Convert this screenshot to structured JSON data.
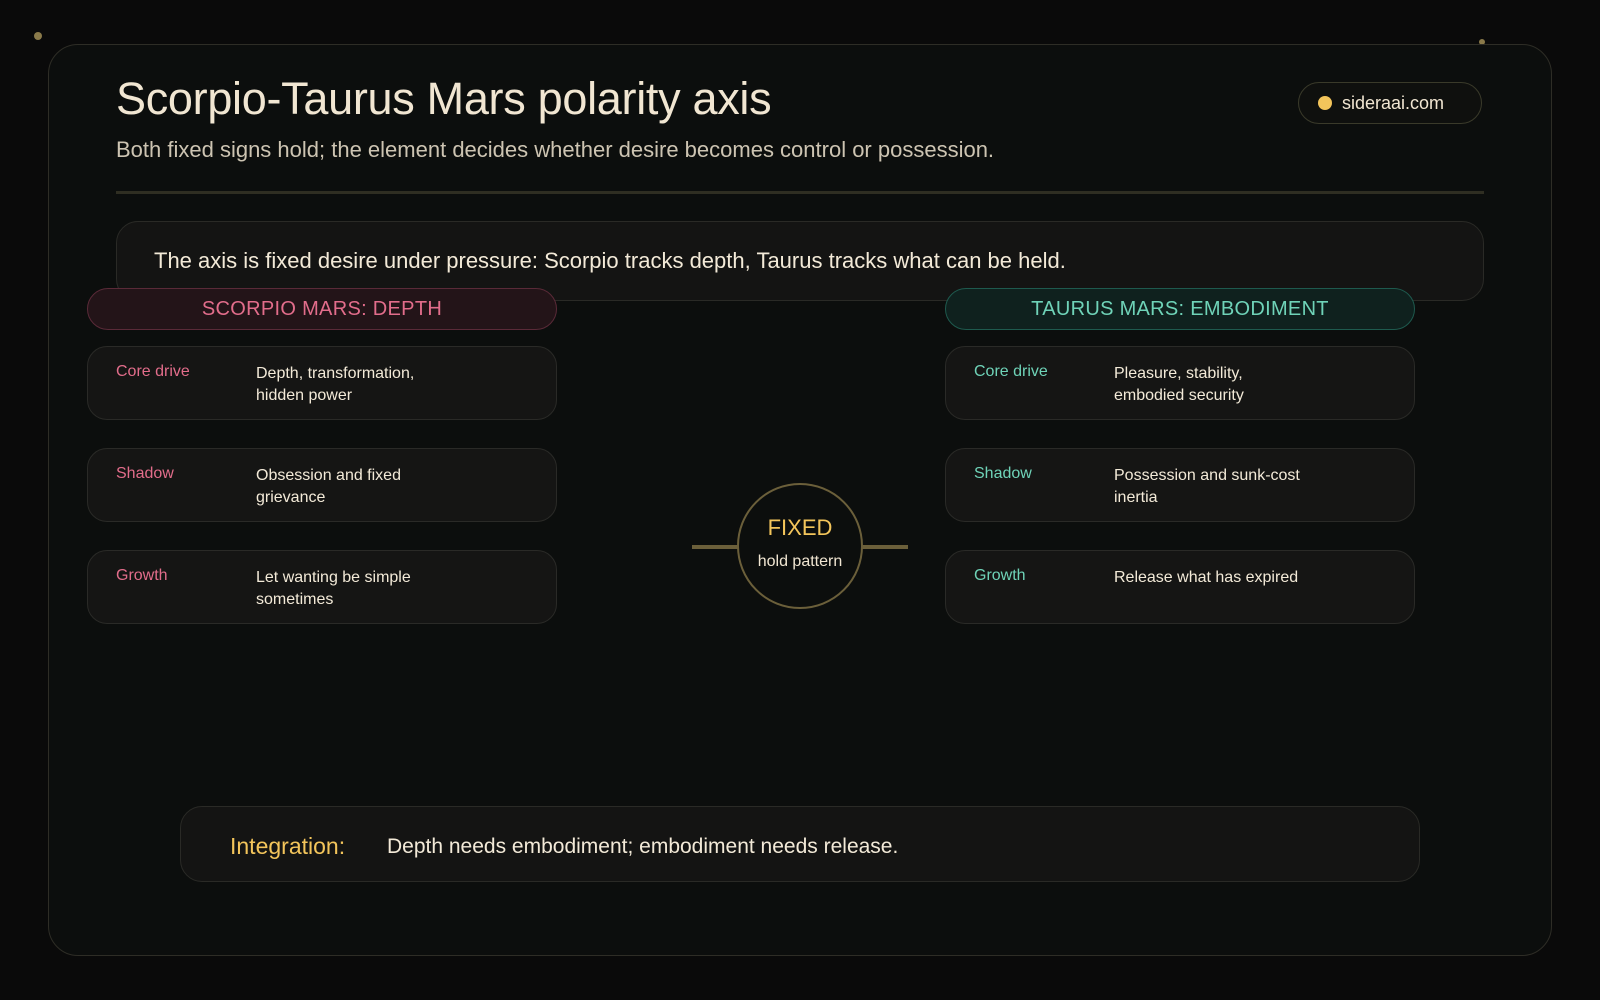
{
  "header": {
    "title": "Scorpio-Taurus Mars polarity axis",
    "subtitle": "Both fixed signs hold; the element decides whether desire becomes control or possession.",
    "site": "sideraai.com"
  },
  "thesis": "The axis is fixed desire under pressure: Scorpio tracks depth, Taurus tracks what can be held.",
  "left": {
    "heading": "SCORPIO MARS: DEPTH",
    "rows": [
      {
        "label": "Core drive",
        "value": "Depth, transformation, hidden power"
      },
      {
        "label": "Shadow",
        "value": "Obsession and fixed grievance"
      },
      {
        "label": "Growth",
        "value": "Let wanting be simple sometimes"
      }
    ]
  },
  "right": {
    "heading": "TAURUS MARS: EMBODIMENT",
    "rows": [
      {
        "label": "Core drive",
        "value": "Pleasure, stability, embodied security"
      },
      {
        "label": "Shadow",
        "value": "Possession and sunk-cost inertia"
      },
      {
        "label": "Growth",
        "value": "Release what has expired"
      }
    ]
  },
  "center": {
    "title": "FIXED",
    "subtitle": "hold pattern"
  },
  "integration": {
    "label": "Integration:",
    "text": "Depth needs embodiment; embodiment needs release."
  },
  "colors": {
    "scorpio_accent": "#e26d8b",
    "taurus_accent": "#6fd3b8",
    "gold_accent": "#f3c55b"
  }
}
